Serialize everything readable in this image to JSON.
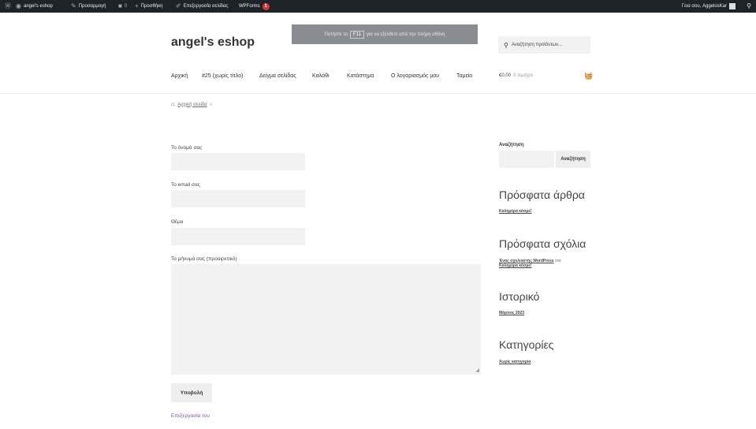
{
  "adminbar": {
    "site_name": "angel's eshop",
    "customize": "Προσαρμογή",
    "comments_count": "0",
    "new_label": "Προσθήκη",
    "edit_page": "Επεξεργασία σελίδας",
    "wpforms": "WPForms",
    "wpforms_badge": "1",
    "greeting": "Γεια σου, AggelosKar"
  },
  "toast": {
    "before": "Πατήστε το",
    "key": "F11",
    "after": "για να εξέλθετε από την πλήρη οθόνη"
  },
  "header": {
    "site_title": "angel's eshop",
    "search_placeholder": "Αναζήτηση προϊόντων..."
  },
  "nav": {
    "items": [
      "Αρχική",
      "#25 (χωρίς τίτλο)",
      "Δείγμα σελίδας",
      "Καλάθι",
      "Κατάστημα",
      "Ο λογαριασμός μου",
      "Ταμείο"
    ]
  },
  "cart": {
    "amount": "€0,00",
    "count": "0 τεμάχια"
  },
  "breadcrumb": {
    "home": "Αρχική σελίδα",
    "separator": "›"
  },
  "form": {
    "name_label": "Το όνομά σας",
    "email_label": "Το email σας",
    "subject_label": "Θέμα",
    "message_label": "Το μήνυμά σας (προαιρετικό)",
    "submit": "Υποβολή",
    "edit_link": "Επεξεργασία του"
  },
  "sidebar": {
    "search_title": "Αναζήτηση",
    "search_button": "Αναζήτηση",
    "recent_posts_title": "Πρόσφατα άρθρα",
    "recent_post_1": "Καλημέρα κόσμε!",
    "recent_comments_title": "Πρόσφατα σχόλια",
    "comment_author": "Ένας σχολιαστής WordPress",
    "comment_on": "στο",
    "comment_post": "Καλημέρα κόσμε!",
    "archives_title": "Ιστορικό",
    "archive_1": "Μάρτιος 2023",
    "categories_title": "Κατηγορίες",
    "category_1": "Χωρίς κατηγορία"
  },
  "colors": {
    "adminbar": "#1d2327",
    "accent_link": "#7f54b3",
    "field_bg": "#f2f2f2"
  }
}
